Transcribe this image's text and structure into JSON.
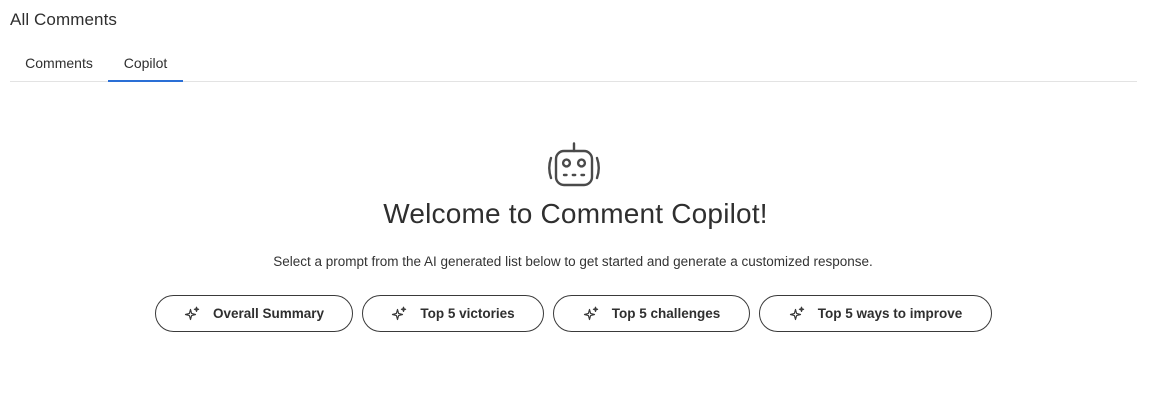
{
  "header": {
    "title": "All Comments"
  },
  "tabs": [
    {
      "label": "Comments",
      "active": false
    },
    {
      "label": "Copilot",
      "active": true
    }
  ],
  "copilot": {
    "icon": "robot-icon",
    "welcome_title": "Welcome to Comment Copilot!",
    "subtitle": "Select a prompt from the AI generated list below to get started and generate a customized response.",
    "prompts": [
      {
        "label": "Overall Summary",
        "icon": "sparkle-icon"
      },
      {
        "label": "Top 5 victories",
        "icon": "sparkle-icon"
      },
      {
        "label": "Top 5 challenges",
        "icon": "sparkle-icon"
      },
      {
        "label": "Top 5 ways to improve",
        "icon": "sparkle-icon"
      }
    ]
  },
  "colors": {
    "accent": "#2a6fd6",
    "text": "#2f2f2f",
    "border": "#3a3a3a"
  }
}
